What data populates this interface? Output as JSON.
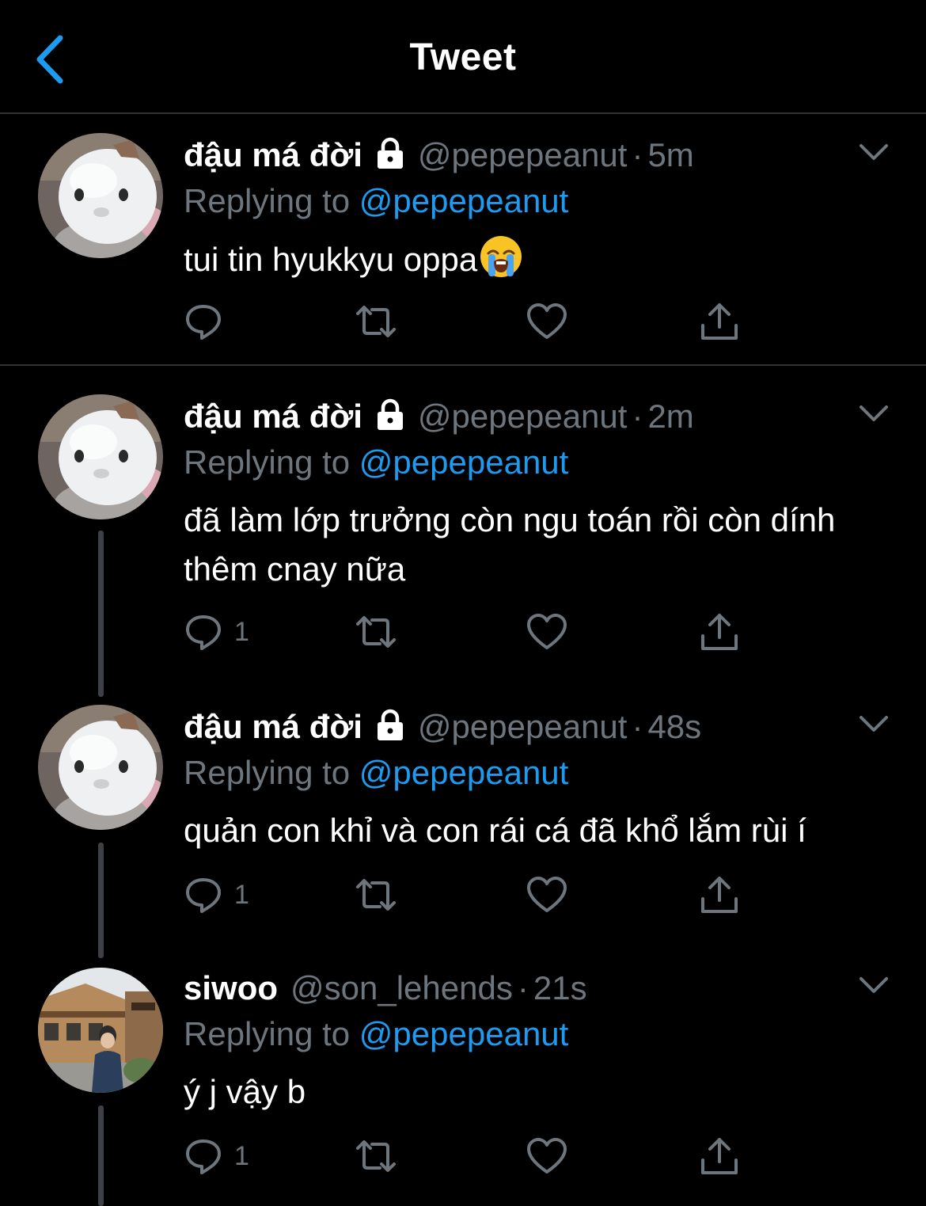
{
  "header": {
    "title": "Tweet",
    "back_icon": "chevron-left-icon"
  },
  "colors": {
    "background": "#000000",
    "accent": "#1d9bf0",
    "muted": "#6e767d",
    "divider": "#2f3336"
  },
  "tweets": [
    {
      "name": "đậu má đời",
      "protected": true,
      "handle": "@pepepeanut",
      "time": "5m",
      "replying_prefix": "Replying to",
      "replying_to": "@pepepeanut",
      "text": "tui tin hyukkyu oppa",
      "emoji": "loudly-crying-face",
      "reply_count": ""
    },
    {
      "name": "đậu má đời",
      "protected": true,
      "handle": "@pepepeanut",
      "time": "2m",
      "replying_prefix": "Replying to",
      "replying_to": "@pepepeanut",
      "text": "đã làm lớp trưởng còn ngu toán rồi còn dính thêm cnay nữa",
      "reply_count": "1"
    },
    {
      "name": "đậu má đời",
      "protected": true,
      "handle": "@pepepeanut",
      "time": "48s",
      "replying_prefix": "Replying to",
      "replying_to": "@pepepeanut",
      "text": "quản con khỉ và con rái cá đã khổ lắm rùi í",
      "reply_count": "1"
    },
    {
      "name": "siwoo",
      "protected": false,
      "handle": "@son_lehends",
      "time": "21s",
      "replying_prefix": "Replying to",
      "replying_to": "@pepepeanut",
      "text": "ý j vậy b",
      "reply_count": "1"
    }
  ]
}
